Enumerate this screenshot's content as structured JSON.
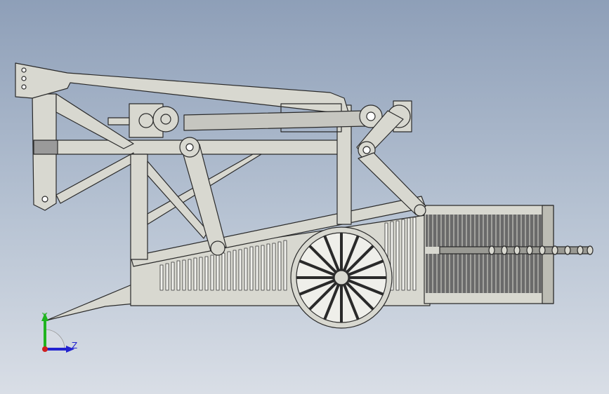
{
  "viewport": {
    "background_top": "#8e9fb8",
    "background_bottom": "#d9dee6"
  },
  "model": {
    "part_fill": "#d8d8d0",
    "part_stroke": "#2a2a2a",
    "dark_fill": "#5a5a5a"
  },
  "triad": {
    "y_label": "Y",
    "z_label": "Z",
    "y_color": "#1fb41f",
    "z_color": "#2222d0",
    "x_color": "#d02020"
  }
}
